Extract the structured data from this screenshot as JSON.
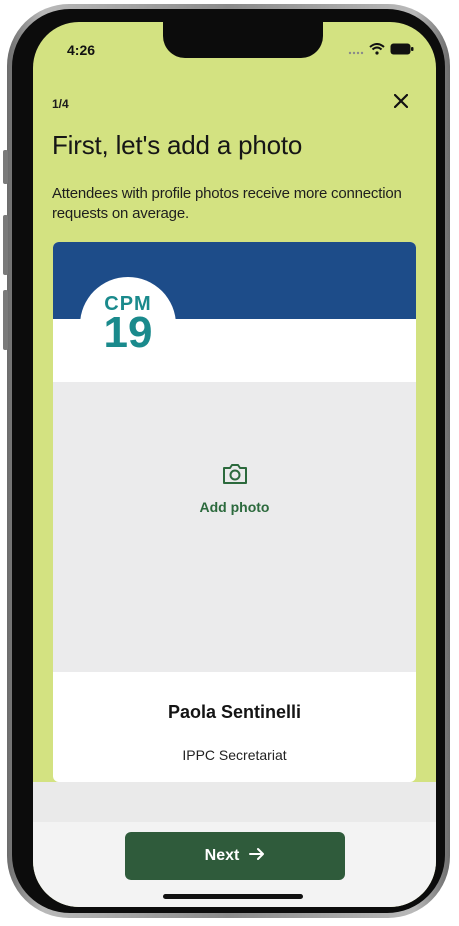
{
  "status_bar": {
    "time": "4:26"
  },
  "onboarding": {
    "step": "1/4",
    "title": "First, let's add a photo",
    "subtitle": "Attendees with profile photos receive more connection requests on average."
  },
  "card": {
    "logo": {
      "top": "CPM",
      "number": "19"
    },
    "add_photo_label": "Add photo",
    "name": "Paola Sentinelli",
    "organization": "IPPC Secretariat"
  },
  "footer": {
    "next_label": "Next"
  },
  "colors": {
    "background": "#d3e281",
    "banner": "#1d4c89",
    "accent": "#2f5b3b",
    "logo": "#1a8a8c"
  }
}
